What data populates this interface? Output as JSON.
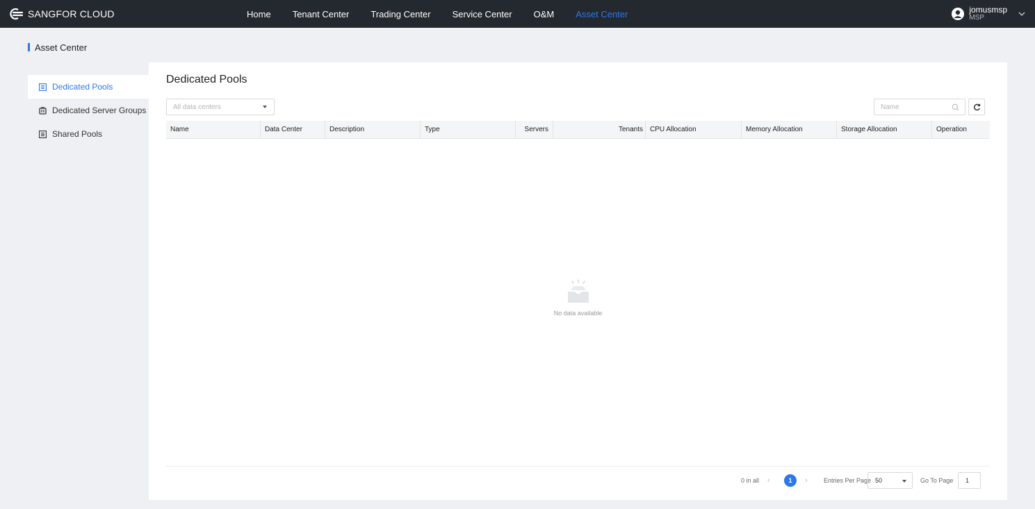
{
  "header": {
    "brand": "SANGFOR CLOUD",
    "nav": [
      {
        "label": "Home"
      },
      {
        "label": "Tenant Center"
      },
      {
        "label": "Trading Center"
      },
      {
        "label": "Service Center"
      },
      {
        "label": "O&M"
      },
      {
        "label": "Asset Center"
      }
    ],
    "active_nav": "Asset Center",
    "user": {
      "name": "jomusmsp",
      "role": "MSP"
    }
  },
  "section": {
    "title": "Asset Center"
  },
  "sidebar": {
    "items": [
      {
        "label": "Dedicated Pools",
        "icon": "pool-icon",
        "active": true
      },
      {
        "label": "Dedicated Server Groups",
        "icon": "server-group-icon",
        "active": false
      },
      {
        "label": "Shared Pools",
        "icon": "pool-icon",
        "active": false
      }
    ]
  },
  "main": {
    "title": "Dedicated Pools",
    "datacenter_select": {
      "placeholder": "All data centers"
    },
    "search": {
      "placeholder": "Name"
    },
    "table": {
      "columns": [
        "Name",
        "Data Center",
        "Description",
        "Type",
        "Servers",
        "Tenants",
        "CPU Allocation",
        "Memory Allocation",
        "Storage Allocation",
        "Operation"
      ],
      "rows": []
    },
    "empty_text": "No data available",
    "pagination": {
      "total_text": "0 in all",
      "current_page": "1",
      "entries_label": "Entries Per Page",
      "entries_value": "50",
      "goto_label": "Go To Page",
      "goto_value": "1"
    }
  },
  "colors": {
    "accent": "#2d78e8",
    "topbar": "#24282f",
    "background": "#eef0f3"
  }
}
